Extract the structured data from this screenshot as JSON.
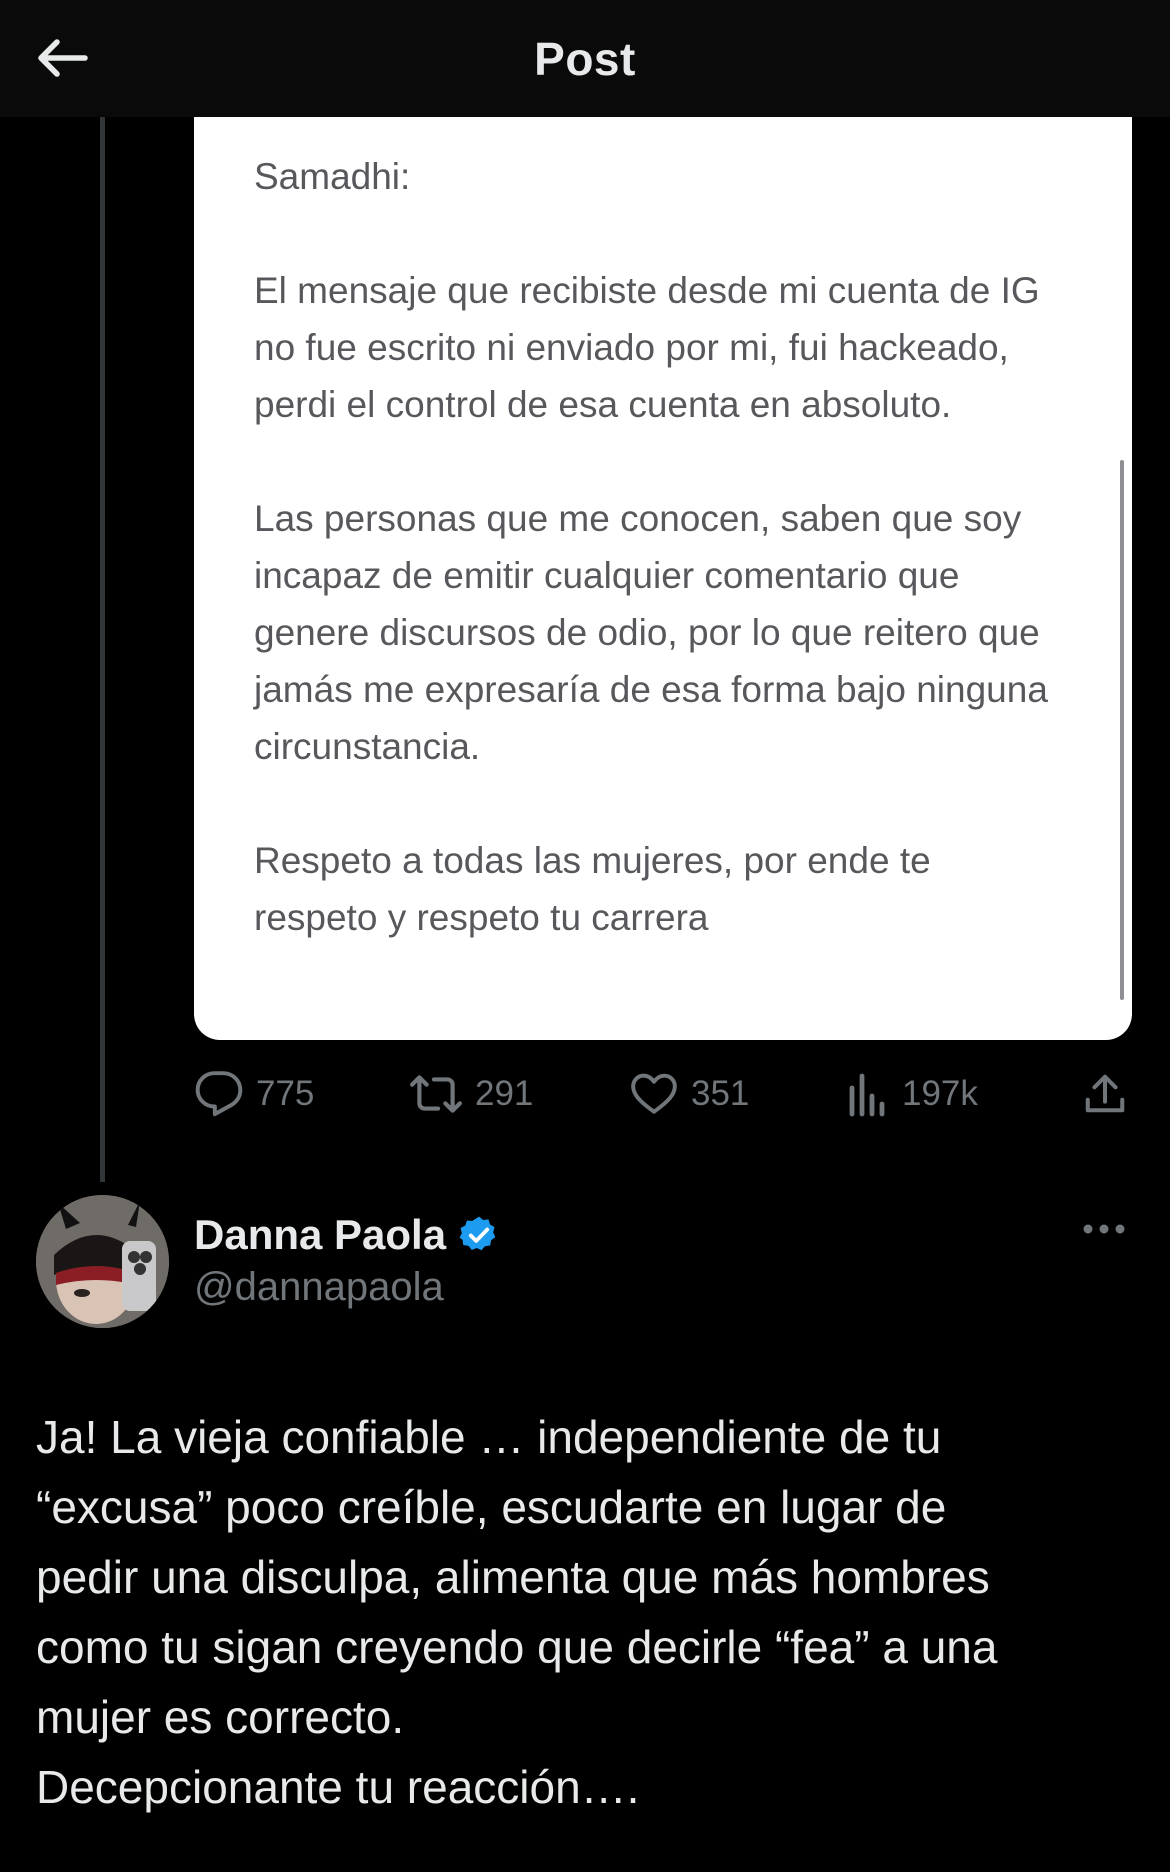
{
  "header": {
    "title": "Post",
    "back_icon": "arrow-left-icon"
  },
  "quoted_image": {
    "paragraphs": [
      [
        "Samadhi:"
      ],
      [
        "El mensaje que recibiste desde mi cuenta de IG",
        "no fue escrito ni enviado por mi, fui hackeado,",
        "perdi el control de esa cuenta en absoluto."
      ],
      [
        "Las personas que me conocen, saben que soy",
        "incapaz de emitir cualquier comentario que",
        "genere discursos de odio, por lo que reitero que",
        "jamás me expresaría de esa forma bajo ninguna",
        "circunstancia."
      ],
      [
        "Respeto a todas las mujeres, por ende te",
        "respeto y respeto tu carrera"
      ]
    ]
  },
  "actions": {
    "replies": "775",
    "reposts": "291",
    "likes": "351",
    "views": "197k",
    "icons": [
      "reply-icon",
      "repost-icon",
      "like-icon",
      "views-icon",
      "share-icon"
    ]
  },
  "reply": {
    "name": "Danna Paola",
    "handle": "@dannapaola",
    "verified": true,
    "verified_color": "#1d9bf0",
    "text_lines": [
      "Ja! La vieja confiable … independiente de tu",
      "“excusa” poco creíble, escudarte en lugar de",
      "pedir una disculpa, alimenta que más hombres",
      "como tu sigan creyendo que decirle “fea” a una",
      "mujer es correcto.",
      "Decepcionante tu reacción…."
    ]
  }
}
